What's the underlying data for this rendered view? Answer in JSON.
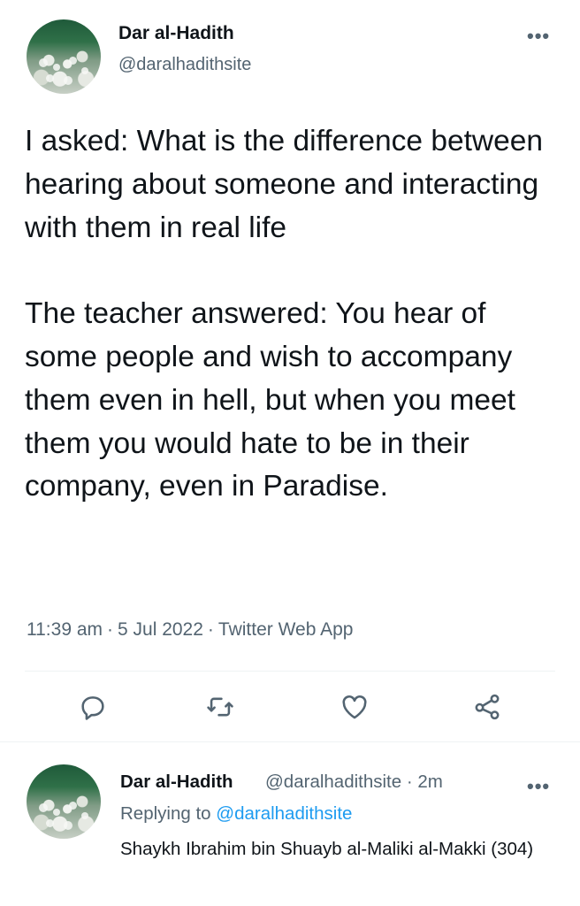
{
  "tweet": {
    "author_name": "Dar al-Hadith",
    "author_handle": "@daralhadithsite",
    "more_label": "•••",
    "text": "I asked: What is the difference between hearing about someone and interacting with them in real life\n\nThe teacher answered: You hear of some people and wish to accompany them even in hell, but when you meet them you would hate to be in their company, even in Paradise.",
    "time": "11:39 am",
    "date": "5 Jul 2022",
    "source": "Twitter Web App",
    "separator": "·"
  },
  "actions": {
    "icons": [
      "reply-icon",
      "retweet-icon",
      "like-icon",
      "share-icon"
    ]
  },
  "reply": {
    "author_name": "Dar al-Hadith",
    "author_handle": "@daralhadithsite",
    "separator": "·",
    "time_ago": "2m",
    "more_label": "•••",
    "replying_prefix": "Replying to",
    "replying_handle": "@daralhadithsite",
    "text": "Shaykh Ibrahim bin Shuayb al-Maliki al-Makki (304)"
  },
  "colors": {
    "text": "#0f1419",
    "secondary": "#536471",
    "link": "#1d9bf0",
    "divider": "#eff3f4",
    "background": "#ffffff"
  }
}
